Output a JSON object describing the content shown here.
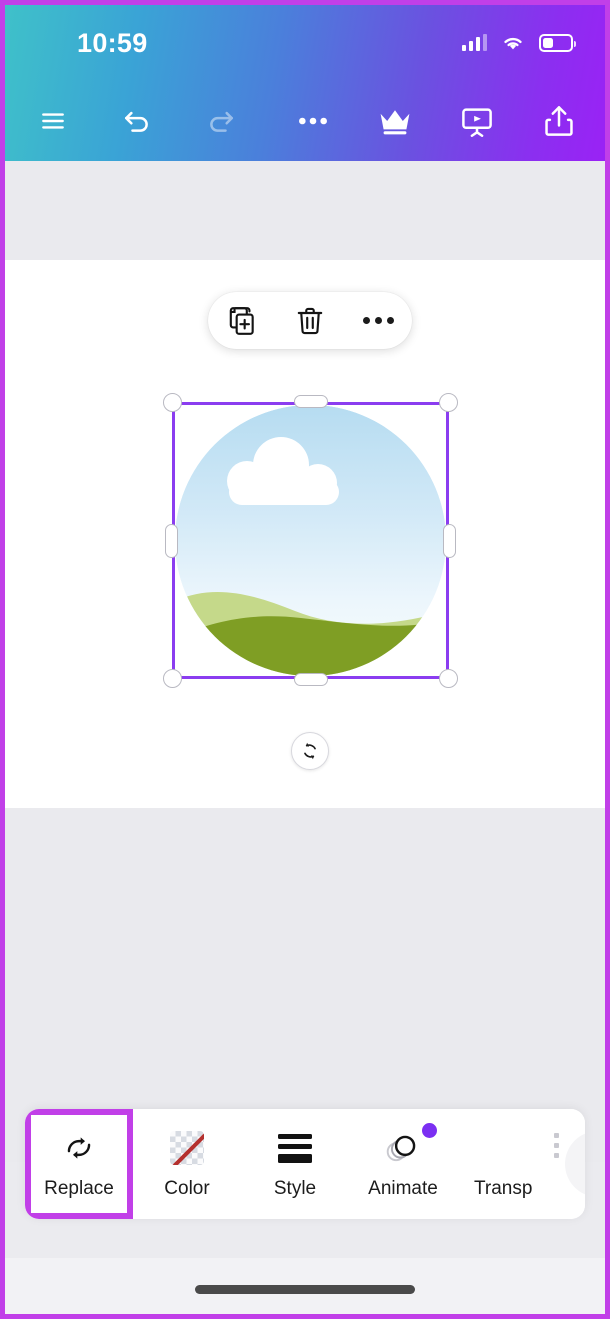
{
  "status_bar": {
    "time": "10:59",
    "signal_icon": "cellular-signal-icon",
    "wifi_icon": "wifi-icon",
    "battery_icon": "battery-icon",
    "battery_level_percent": 38
  },
  "app_bar": {
    "menu_label": "menu-icon",
    "undo_label": "undo-icon",
    "redo_label": "redo-icon",
    "more_label": "more-options-icon",
    "pro_label": "crown-icon",
    "present_label": "present-icon",
    "share_label": "share-icon"
  },
  "context_toolbar": {
    "duplicate_label": "duplicate-icon",
    "delete_label": "trash-icon",
    "more_label": "more-icon"
  },
  "canvas": {
    "element_type": "image",
    "artwork_name": "circular-landscape-illustration",
    "selection_color": "#8b3df0",
    "sky_top_color": "#b6dcf1",
    "sky_bottom_color": "#f6fbfe",
    "cloud_color": "#ffffff",
    "hill_back_color": "#c5d98a",
    "hill_front_color": "#7f9e24",
    "rotate_label": "rotate-icon"
  },
  "bottom_toolbar": {
    "items": [
      {
        "label": "Replace",
        "icon": "replace-icon",
        "selected": true,
        "badge": false
      },
      {
        "label": "Color",
        "icon": "color-swatch-icon",
        "selected": false,
        "badge": false
      },
      {
        "label": "Style",
        "icon": "style-icon",
        "selected": false,
        "badge": false
      },
      {
        "label": "Animate",
        "icon": "animate-icon",
        "selected": false,
        "badge": true
      },
      {
        "label": "Transp",
        "icon": "transparency-icon",
        "selected": false,
        "badge": false
      }
    ],
    "close_label": "close-icon",
    "highlight_color": "#c13fe8",
    "badge_color": "#7b2ff2"
  },
  "system": {
    "home_indicator": "home-indicator"
  }
}
